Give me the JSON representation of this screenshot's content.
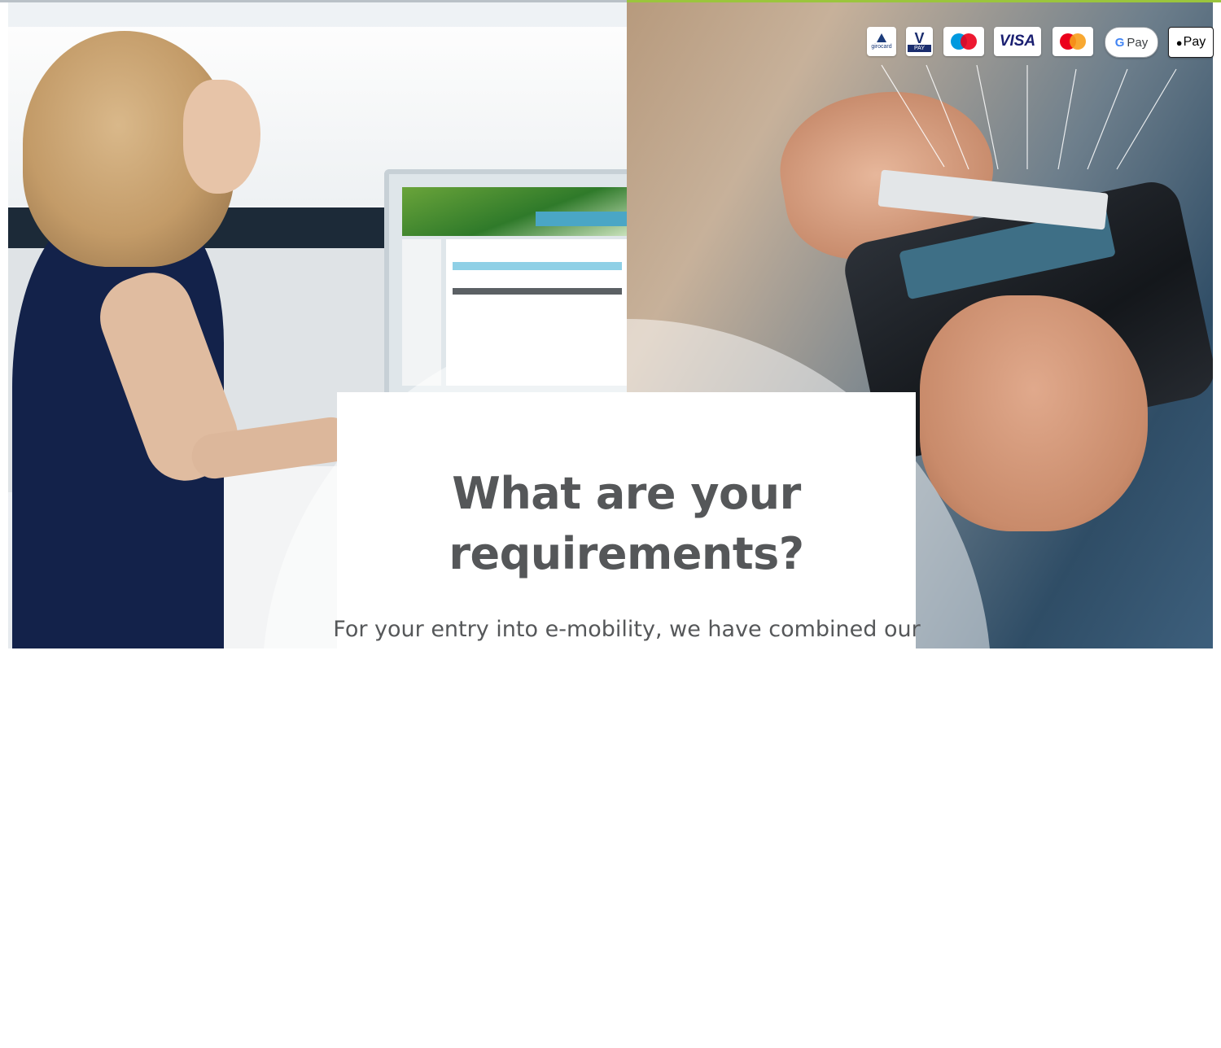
{
  "hero": {
    "headline_line1": "What are your",
    "headline_line2": "requirements?",
    "body_text": "For your entry into e-mobility, we have combined our"
  },
  "payment_methods": [
    "girocard",
    "V PAY",
    "maestro",
    "VISA",
    "mastercard",
    "G Pay",
    "Pay"
  ],
  "payment_labels": {
    "girocard": "girocard",
    "vpay_v": "V",
    "vpay_pay": "PAY",
    "visa": "VISA",
    "gpay_g": "G",
    "gpay_pay": "Pay",
    "applepay": "Pay"
  },
  "colors": {
    "text": "#555759",
    "accent_green": "#9bc53d",
    "visa_blue": "#1a1f71",
    "mastercard_red": "#eb001b",
    "mastercard_yellow": "#f79e1b",
    "maestro_blue": "#0099df"
  },
  "icons": {
    "apple": "apple-icon",
    "google": "google-g-icon"
  }
}
